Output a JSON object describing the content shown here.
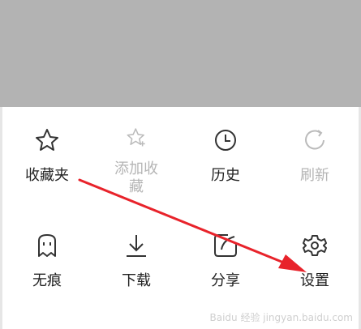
{
  "menu": {
    "items": [
      {
        "label": "收藏夹",
        "icon": "star-icon",
        "enabled": true
      },
      {
        "label": "添加收藏",
        "icon": "star-plus-icon",
        "enabled": false
      },
      {
        "label": "历史",
        "icon": "clock-icon",
        "enabled": true
      },
      {
        "label": "刷新",
        "icon": "refresh-icon",
        "enabled": false
      },
      {
        "label": "无痕",
        "icon": "ghost-icon",
        "enabled": true
      },
      {
        "label": "下载",
        "icon": "download-icon",
        "enabled": true
      },
      {
        "label": "分享",
        "icon": "share-icon",
        "enabled": true
      },
      {
        "label": "设置",
        "icon": "gear-icon",
        "enabled": true
      }
    ]
  },
  "colors": {
    "overlay": "#b3b3b3",
    "arrow": "#e8232b",
    "text": "#222222",
    "disabled_text": "#b5b5b5"
  },
  "watermark": "Baidu 经验 jingyan.baidu.com"
}
